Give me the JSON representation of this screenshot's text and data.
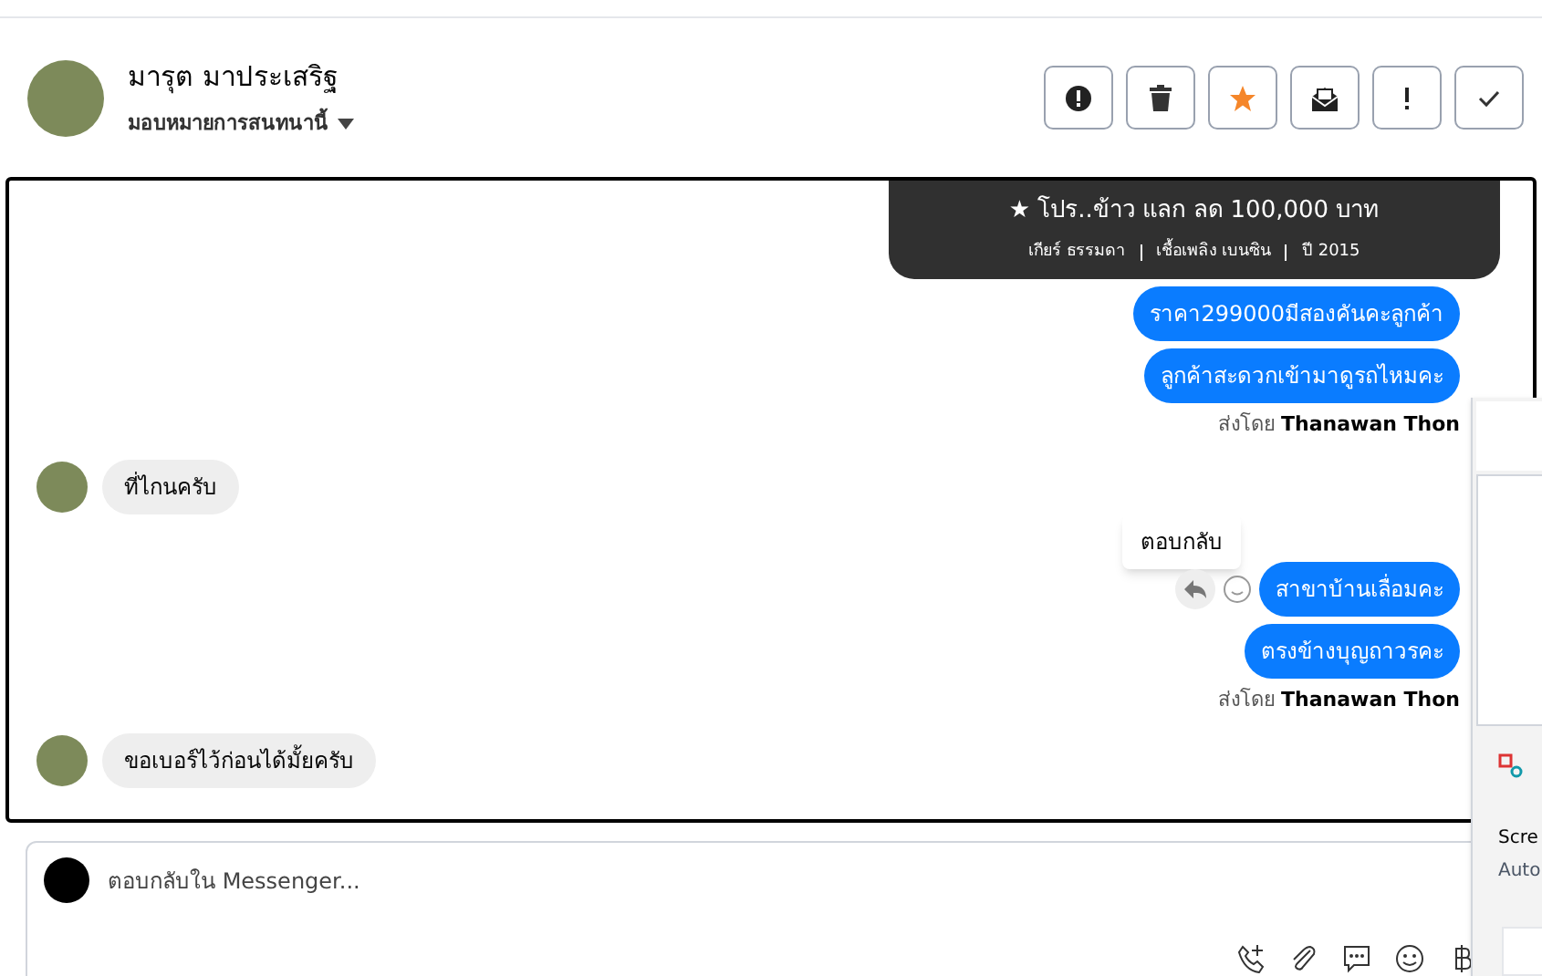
{
  "header": {
    "name": "มารุต มาประเสริฐ",
    "assign": "มอบหมายการสนทนานี้",
    "actions": [
      {
        "kind": "alert"
      },
      {
        "kind": "trash"
      },
      {
        "kind": "star"
      },
      {
        "kind": "mail"
      },
      {
        "kind": "exclaim"
      },
      {
        "kind": "check"
      }
    ]
  },
  "messages": [
    {
      "kind": "card",
      "promo": "★ โปร..ข้าว แลก ลด 100,000 บาท",
      "specs": [
        "เกียร์ ธรรมดา",
        "เชื้อเพลิง เบนซิน",
        "ปี 2015"
      ]
    },
    {
      "kind": "out",
      "text": "ราคา299000มีสองคันคะลูกค้า"
    },
    {
      "kind": "out",
      "text": "ลูกค้าสะดวกเข้ามาดูรถไหมคะ"
    },
    {
      "kind": "sender",
      "prefix": "ส่งโดย",
      "name": "Thanawan Thon"
    },
    {
      "kind": "in",
      "text": "ที่ไกนครับ"
    },
    {
      "kind": "tooltip",
      "text": "ตอบกลับ"
    },
    {
      "kind": "out",
      "text": "สาขาบ้านเลื่อมคะ",
      "actions": true
    },
    {
      "kind": "out",
      "text": "ตรงข้างบุญถาวรคะ"
    },
    {
      "kind": "sender",
      "prefix": "ส่งโดย",
      "name": "Thanawan Thon"
    },
    {
      "kind": "in",
      "text": "ขอเบอร์ไว้ก่อนได้มั้ยครับ"
    }
  ],
  "composer": {
    "placeholder": "ตอบกลับใน Messenger...",
    "tools": [
      {
        "kind": "call"
      },
      {
        "kind": "clip"
      },
      {
        "kind": "chat"
      },
      {
        "kind": "emoji"
      },
      {
        "kind": "baht"
      }
    ]
  },
  "overlay": {
    "title": "Scre",
    "subtitle": "Auto"
  }
}
